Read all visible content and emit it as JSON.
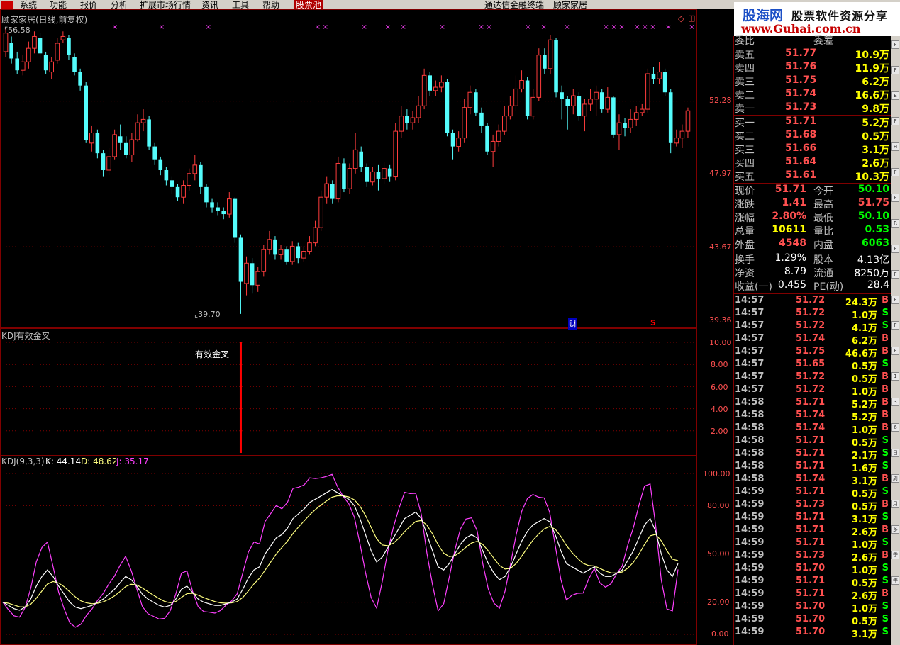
{
  "menu": {
    "items": [
      "系统",
      "功能",
      "报价",
      "分析",
      "扩展市场行情",
      "资讯",
      "工具",
      "帮助",
      "股票池"
    ],
    "center_left": "通达信金融终端",
    "center_right": "顾家家居"
  },
  "brand": {
    "part1": "股海网",
    "part2": "股票软件资源分享",
    "part3": "www.Guhai.com.cn"
  },
  "main_chart": {
    "title": "顾家家居(日线,前复权)",
    "high_label": "56.58",
    "low_label": "39.70",
    "y_ticks": [
      "52.28",
      "47.97",
      "43.67",
      "39.36"
    ],
    "finance_marker": "财",
    "s_marker": "S",
    "candles": [
      {
        "o": 55.2,
        "c": 56.3,
        "h": 56.58,
        "l": 54.9
      },
      {
        "o": 55.7,
        "c": 54.8,
        "h": 56.1,
        "l": 54.5
      },
      {
        "o": 54.8,
        "c": 54.1,
        "h": 55.2,
        "l": 53.9
      },
      {
        "o": 54.1,
        "c": 54.6,
        "h": 55.0,
        "l": 53.8
      },
      {
        "o": 54.6,
        "c": 55.4,
        "h": 55.8,
        "l": 54.2
      },
      {
        "o": 55.4,
        "c": 56.1,
        "h": 56.4,
        "l": 55.1
      },
      {
        "o": 56.0,
        "c": 55.1,
        "h": 56.3,
        "l": 54.8
      },
      {
        "o": 55.0,
        "c": 54.1,
        "h": 55.2,
        "l": 53.9
      },
      {
        "o": 54.0,
        "c": 54.6,
        "h": 54.9,
        "l": 53.6
      },
      {
        "o": 54.7,
        "c": 55.7,
        "h": 56.0,
        "l": 54.5
      },
      {
        "o": 55.9,
        "c": 56.1,
        "h": 56.4,
        "l": 55.7
      },
      {
        "o": 56.0,
        "c": 55.0,
        "h": 56.2,
        "l": 54.7
      },
      {
        "o": 54.9,
        "c": 54.0,
        "h": 55.1,
        "l": 53.8
      },
      {
        "o": 54.0,
        "c": 53.2,
        "h": 54.2,
        "l": 52.9
      },
      {
        "o": 53.2,
        "c": 50.0,
        "h": 53.4,
        "l": 49.8
      },
      {
        "o": 49.8,
        "c": 50.4,
        "h": 50.8,
        "l": 49.3
      },
      {
        "o": 50.4,
        "c": 49.2,
        "h": 50.6,
        "l": 48.9
      },
      {
        "o": 49.2,
        "c": 48.2,
        "h": 49.4,
        "l": 47.8
      },
      {
        "o": 48.2,
        "c": 49.0,
        "h": 49.5,
        "l": 47.9
      },
      {
        "o": 49.0,
        "c": 50.3,
        "h": 50.6,
        "l": 48.8
      },
      {
        "o": 50.2,
        "c": 49.8,
        "h": 50.9,
        "l": 49.4
      },
      {
        "o": 49.8,
        "c": 49.1,
        "h": 50.2,
        "l": 48.9
      },
      {
        "o": 49.1,
        "c": 50.0,
        "h": 50.4,
        "l": 48.7
      },
      {
        "o": 50.0,
        "c": 51.0,
        "h": 51.5,
        "l": 49.9
      },
      {
        "o": 51.0,
        "c": 51.2,
        "h": 51.8,
        "l": 50.5
      },
      {
        "o": 51.2,
        "c": 49.6,
        "h": 51.4,
        "l": 49.4
      },
      {
        "o": 49.6,
        "c": 48.8,
        "h": 49.8,
        "l": 48.5
      },
      {
        "o": 48.8,
        "c": 48.2,
        "h": 49.0,
        "l": 47.9
      },
      {
        "o": 48.2,
        "c": 47.6,
        "h": 48.4,
        "l": 47.3
      },
      {
        "o": 47.6,
        "c": 47.2,
        "h": 47.8,
        "l": 46.8
      },
      {
        "o": 47.2,
        "c": 46.6,
        "h": 47.4,
        "l": 46.4
      },
      {
        "o": 46.6,
        "c": 47.3,
        "h": 47.6,
        "l": 46.2
      },
      {
        "o": 47.3,
        "c": 48.0,
        "h": 48.3,
        "l": 47.0
      },
      {
        "o": 48.0,
        "c": 48.5,
        "h": 49.1,
        "l": 47.6
      },
      {
        "o": 48.5,
        "c": 47.2,
        "h": 48.7,
        "l": 46.8
      },
      {
        "o": 47.2,
        "c": 46.3,
        "h": 47.4,
        "l": 46.0
      },
      {
        "o": 46.3,
        "c": 46.0,
        "h": 46.5,
        "l": 45.7
      },
      {
        "o": 46.0,
        "c": 45.8,
        "h": 46.3,
        "l": 45.5
      },
      {
        "o": 45.8,
        "c": 45.6,
        "h": 46.0,
        "l": 45.3
      },
      {
        "o": 45.6,
        "c": 46.5,
        "h": 46.9,
        "l": 45.4
      },
      {
        "o": 46.5,
        "c": 44.2,
        "h": 46.6,
        "l": 43.9
      },
      {
        "o": 44.2,
        "c": 41.6,
        "h": 44.4,
        "l": 39.7
      },
      {
        "o": 41.5,
        "c": 42.7,
        "h": 43.1,
        "l": 40.8
      },
      {
        "o": 42.7,
        "c": 41.4,
        "h": 43.0,
        "l": 40.9
      },
      {
        "o": 41.4,
        "c": 42.2,
        "h": 42.5,
        "l": 41.0
      },
      {
        "o": 42.2,
        "c": 43.5,
        "h": 43.8,
        "l": 41.9
      },
      {
        "o": 43.5,
        "c": 44.1,
        "h": 44.6,
        "l": 43.2
      },
      {
        "o": 44.1,
        "c": 43.2,
        "h": 44.3,
        "l": 42.9
      },
      {
        "o": 43.2,
        "c": 43.5,
        "h": 43.8,
        "l": 42.9
      },
      {
        "o": 43.5,
        "c": 42.8,
        "h": 43.7,
        "l": 42.6
      },
      {
        "o": 42.8,
        "c": 43.7,
        "h": 44.0,
        "l": 42.6
      },
      {
        "o": 43.7,
        "c": 43.0,
        "h": 43.9,
        "l": 42.7
      },
      {
        "o": 43.0,
        "c": 43.4,
        "h": 43.7,
        "l": 42.8
      },
      {
        "o": 43.4,
        "c": 43.9,
        "h": 44.3,
        "l": 43.2
      },
      {
        "o": 43.9,
        "c": 44.8,
        "h": 45.2,
        "l": 43.7
      },
      {
        "o": 44.8,
        "c": 46.6,
        "h": 47.0,
        "l": 44.6
      },
      {
        "o": 46.6,
        "c": 47.4,
        "h": 47.8,
        "l": 46.2
      },
      {
        "o": 47.4,
        "c": 46.5,
        "h": 47.6,
        "l": 46.2
      },
      {
        "o": 46.5,
        "c": 48.6,
        "h": 49.0,
        "l": 46.3
      },
      {
        "o": 48.6,
        "c": 47.1,
        "h": 48.9,
        "l": 46.9
      },
      {
        "o": 47.1,
        "c": 48.3,
        "h": 48.6,
        "l": 46.8
      },
      {
        "o": 48.3,
        "c": 49.4,
        "h": 50.4,
        "l": 48.0
      },
      {
        "o": 49.3,
        "c": 48.4,
        "h": 49.6,
        "l": 48.1
      },
      {
        "o": 48.4,
        "c": 47.5,
        "h": 48.6,
        "l": 47.2
      },
      {
        "o": 47.5,
        "c": 48.1,
        "h": 48.4,
        "l": 47.3
      },
      {
        "o": 48.1,
        "c": 47.7,
        "h": 48.5,
        "l": 47.0
      },
      {
        "o": 47.7,
        "c": 48.3,
        "h": 48.7,
        "l": 47.4
      },
      {
        "o": 48.3,
        "c": 47.8,
        "h": 48.5,
        "l": 47.5
      },
      {
        "o": 47.8,
        "c": 50.5,
        "h": 51.0,
        "l": 47.6
      },
      {
        "o": 50.5,
        "c": 51.4,
        "h": 52.0,
        "l": 50.1
      },
      {
        "o": 51.4,
        "c": 51.0,
        "h": 51.8,
        "l": 50.6
      },
      {
        "o": 51.0,
        "c": 51.3,
        "h": 51.7,
        "l": 50.6
      },
      {
        "o": 51.3,
        "c": 52.0,
        "h": 52.6,
        "l": 51.0
      },
      {
        "o": 52.0,
        "c": 53.8,
        "h": 54.2,
        "l": 51.8
      },
      {
        "o": 53.8,
        "c": 52.9,
        "h": 54.0,
        "l": 52.6
      },
      {
        "o": 52.9,
        "c": 53.1,
        "h": 53.5,
        "l": 52.6
      },
      {
        "o": 53.1,
        "c": 53.4,
        "h": 53.8,
        "l": 52.8
      },
      {
        "o": 53.4,
        "c": 50.4,
        "h": 53.6,
        "l": 50.2
      },
      {
        "o": 50.4,
        "c": 49.6,
        "h": 50.6,
        "l": 48.8
      },
      {
        "o": 49.6,
        "c": 50.1,
        "h": 50.5,
        "l": 49.3
      },
      {
        "o": 50.1,
        "c": 51.9,
        "h": 52.4,
        "l": 49.8
      },
      {
        "o": 51.9,
        "c": 52.8,
        "h": 53.2,
        "l": 51.5
      },
      {
        "o": 52.8,
        "c": 51.6,
        "h": 53.0,
        "l": 51.4
      },
      {
        "o": 51.6,
        "c": 50.8,
        "h": 51.9,
        "l": 50.4
      },
      {
        "o": 50.8,
        "c": 49.3,
        "h": 51.0,
        "l": 49.1
      },
      {
        "o": 49.3,
        "c": 49.9,
        "h": 50.3,
        "l": 48.4
      },
      {
        "o": 49.9,
        "c": 50.5,
        "h": 50.9,
        "l": 49.6
      },
      {
        "o": 50.5,
        "c": 51.4,
        "h": 52.0,
        "l": 50.3
      },
      {
        "o": 51.4,
        "c": 52.0,
        "h": 52.6,
        "l": 51.2
      },
      {
        "o": 52.0,
        "c": 53.0,
        "h": 53.8,
        "l": 51.7
      },
      {
        "o": 53.0,
        "c": 53.5,
        "h": 54.1,
        "l": 52.8
      },
      {
        "o": 53.5,
        "c": 51.4,
        "h": 53.7,
        "l": 51.2
      },
      {
        "o": 51.4,
        "c": 52.5,
        "h": 53.0,
        "l": 51.2
      },
      {
        "o": 52.5,
        "c": 55.0,
        "h": 55.4,
        "l": 52.3
      },
      {
        "o": 55.0,
        "c": 54.2,
        "h": 55.4,
        "l": 53.9
      },
      {
        "o": 54.2,
        "c": 55.9,
        "h": 56.2,
        "l": 53.9
      },
      {
        "o": 55.9,
        "c": 52.8,
        "h": 56.0,
        "l": 52.5
      },
      {
        "o": 52.8,
        "c": 52.4,
        "h": 53.2,
        "l": 51.2
      },
      {
        "o": 52.4,
        "c": 52.0,
        "h": 52.6,
        "l": 50.6
      },
      {
        "o": 52.0,
        "c": 52.6,
        "h": 53.0,
        "l": 51.5
      },
      {
        "o": 52.6,
        "c": 51.4,
        "h": 52.8,
        "l": 51.1
      },
      {
        "o": 51.4,
        "c": 52.1,
        "h": 52.4,
        "l": 50.5
      },
      {
        "o": 52.1,
        "c": 52.4,
        "h": 53.0,
        "l": 51.7
      },
      {
        "o": 52.4,
        "c": 52.8,
        "h": 53.2,
        "l": 51.4
      },
      {
        "o": 52.8,
        "c": 51.8,
        "h": 53.0,
        "l": 51.6
      },
      {
        "o": 51.8,
        "c": 52.5,
        "h": 53.1,
        "l": 51.6
      },
      {
        "o": 52.5,
        "c": 50.3,
        "h": 52.6,
        "l": 50.1
      },
      {
        "o": 50.3,
        "c": 51.0,
        "h": 51.5,
        "l": 49.4
      },
      {
        "o": 51.0,
        "c": 50.7,
        "h": 51.3,
        "l": 50.2
      },
      {
        "o": 50.7,
        "c": 51.2,
        "h": 51.8,
        "l": 50.4
      },
      {
        "o": 51.2,
        "c": 51.6,
        "h": 52.0,
        "l": 50.8
      },
      {
        "o": 51.6,
        "c": 51.8,
        "h": 52.1,
        "l": 51.4
      },
      {
        "o": 51.8,
        "c": 53.9,
        "h": 54.2,
        "l": 51.6
      },
      {
        "o": 53.9,
        "c": 53.6,
        "h": 54.3,
        "l": 53.3
      },
      {
        "o": 53.6,
        "c": 54.0,
        "h": 54.6,
        "l": 53.3
      },
      {
        "o": 54.0,
        "c": 52.8,
        "h": 54.2,
        "l": 52.6
      },
      {
        "o": 52.8,
        "c": 49.8,
        "h": 53.0,
        "l": 49.2
      },
      {
        "o": 49.8,
        "c": 50.1,
        "h": 50.6,
        "l": 49.6
      },
      {
        "o": 50.1,
        "c": 50.5,
        "h": 50.9,
        "l": 49.5
      },
      {
        "o": 50.5,
        "c": 51.71,
        "h": 51.9,
        "l": 50.1
      }
    ],
    "markers_x": [
      14,
      20,
      26,
      40,
      41,
      46,
      49,
      51,
      56,
      61,
      62,
      67,
      69,
      72,
      77,
      78,
      79,
      81,
      82,
      83,
      85,
      88
    ]
  },
  "kdj_signal": {
    "title": "KDJ有效金叉",
    "signal_label": "有效金叉",
    "y_ticks": [
      "10.00",
      "8.00",
      "6.00",
      "4.00",
      "2.00"
    ],
    "signal_index": 41,
    "signal_value": 10
  },
  "kdj": {
    "title": "KDJ(9,3,3)",
    "k_label": "K: 44.14",
    "d_label": "D: 48.62",
    "j_label": "J: 35.17",
    "y_ticks": [
      "100.00",
      "80.00",
      "50.00",
      "20.00",
      "0.00"
    ],
    "colors": {
      "k": "#ffffff",
      "d": "#ffff80",
      "j": "#ff40ff"
    },
    "k": [
      20,
      18,
      16,
      15,
      17,
      22,
      30,
      36,
      40,
      36,
      30,
      25,
      20,
      17,
      16,
      17,
      18,
      20,
      22,
      25,
      28,
      32,
      36,
      34,
      30,
      25,
      22,
      20,
      18,
      17,
      18,
      22,
      28,
      30,
      26,
      22,
      20,
      19,
      18,
      18,
      19,
      20,
      22,
      28,
      35,
      40,
      42,
      50,
      55,
      60,
      62,
      66,
      72,
      75,
      78,
      82,
      84,
      86,
      88,
      90,
      88,
      86,
      84,
      80,
      72,
      62,
      52,
      45,
      48,
      54,
      60,
      66,
      72,
      74,
      76,
      72,
      62,
      52,
      42,
      40,
      44,
      50,
      56,
      60,
      62,
      60,
      52,
      44,
      38,
      34,
      36,
      42,
      50,
      58,
      64,
      68,
      70,
      72,
      70,
      62,
      52,
      44,
      42,
      40,
      38,
      40,
      42,
      38,
      36,
      36,
      38,
      40,
      46,
      52,
      60,
      68,
      72,
      64,
      50,
      40,
      36,
      44
    ]
  },
  "quote": {
    "webi_label": "委比",
    "webi_value": "",
    "wecha_label": "委差",
    "wecha_value": "",
    "sell": [
      {
        "label": "卖五",
        "price": "51.77",
        "vol": "10.9万"
      },
      {
        "label": "卖四",
        "price": "51.76",
        "vol": "11.9万"
      },
      {
        "label": "卖三",
        "price": "51.75",
        "vol": "6.2万"
      },
      {
        "label": "卖二",
        "price": "51.74",
        "vol": "16.6万"
      },
      {
        "label": "卖一",
        "price": "51.73",
        "vol": "9.8万"
      }
    ],
    "buy": [
      {
        "label": "买一",
        "price": "51.71",
        "vol": "5.2万"
      },
      {
        "label": "买二",
        "price": "51.68",
        "vol": "0.5万"
      },
      {
        "label": "买三",
        "price": "51.66",
        "vol": "3.1万"
      },
      {
        "label": "买四",
        "price": "51.64",
        "vol": "2.6万"
      },
      {
        "label": "买五",
        "price": "51.61",
        "vol": "10.3万"
      }
    ],
    "stats": [
      {
        "l1": "现价",
        "v1": "51.71",
        "c1": "red",
        "l2": "今开",
        "v2": "50.10",
        "c2": "green"
      },
      {
        "l1": "涨跌",
        "v1": "1.41",
        "c1": "red",
        "l2": "最高",
        "v2": "51.75",
        "c2": "red"
      },
      {
        "l1": "涨幅",
        "v1": "2.80%",
        "c1": "red",
        "l2": "最低",
        "v2": "50.10",
        "c2": "green"
      },
      {
        "l1": "总量",
        "v1": "10611",
        "c1": "yellow",
        "l2": "量比",
        "v2": "0.53",
        "c2": "green"
      },
      {
        "l1": "外盘",
        "v1": "4548",
        "c1": "red",
        "l2": "内盘",
        "v2": "6063",
        "c2": "green"
      }
    ],
    "fund": [
      {
        "l1": "换手",
        "v1": "1.29%",
        "l2": "股本",
        "v2": "4.13亿"
      },
      {
        "l1": "净资",
        "v1": "8.79",
        "l2": "流通",
        "v2": "8250万"
      },
      {
        "l1": "收益(一)",
        "v1": "0.455",
        "l2": "PE(动)",
        "v2": "28.4"
      }
    ]
  },
  "ticks": [
    {
      "t": "14:57",
      "p": "51.72",
      "pc": "red",
      "q": "24.3万",
      "s": "B"
    },
    {
      "t": "14:57",
      "p": "51.72",
      "pc": "red",
      "q": "1.0万",
      "s": "S"
    },
    {
      "t": "14:57",
      "p": "51.72",
      "pc": "red",
      "q": "4.1万",
      "s": "S"
    },
    {
      "t": "14:57",
      "p": "51.74",
      "pc": "red",
      "q": "6.2万",
      "s": "B"
    },
    {
      "t": "14:57",
      "p": "51.75",
      "pc": "red",
      "q": "46.6万",
      "s": "B"
    },
    {
      "t": "14:57",
      "p": "51.65",
      "pc": "red",
      "q": "0.5万",
      "s": "S"
    },
    {
      "t": "14:57",
      "p": "51.72",
      "pc": "red",
      "q": "0.5万",
      "s": "B"
    },
    {
      "t": "14:57",
      "p": "51.72",
      "pc": "red",
      "q": "1.0万",
      "s": "B"
    },
    {
      "t": "14:58",
      "p": "51.71",
      "pc": "red",
      "q": "5.2万",
      "s": "B"
    },
    {
      "t": "14:58",
      "p": "51.74",
      "pc": "red",
      "q": "5.2万",
      "s": "B"
    },
    {
      "t": "14:58",
      "p": "51.74",
      "pc": "red",
      "q": "1.0万",
      "s": "B"
    },
    {
      "t": "14:58",
      "p": "51.71",
      "pc": "red",
      "q": "0.5万",
      "s": "S"
    },
    {
      "t": "14:58",
      "p": "51.71",
      "pc": "red",
      "q": "2.1万",
      "s": "S"
    },
    {
      "t": "14:58",
      "p": "51.71",
      "pc": "red",
      "q": "1.6万",
      "s": "S"
    },
    {
      "t": "14:58",
      "p": "51.74",
      "pc": "red",
      "q": "3.1万",
      "s": "B"
    },
    {
      "t": "14:59",
      "p": "51.71",
      "pc": "red",
      "q": "0.5万",
      "s": "S"
    },
    {
      "t": "14:59",
      "p": "51.73",
      "pc": "red",
      "q": "0.5万",
      "s": "B"
    },
    {
      "t": "14:59",
      "p": "51.71",
      "pc": "red",
      "q": "3.1万",
      "s": "S"
    },
    {
      "t": "14:59",
      "p": "51.71",
      "pc": "red",
      "q": "2.6万",
      "s": "B"
    },
    {
      "t": "14:59",
      "p": "51.71",
      "pc": "red",
      "q": "1.0万",
      "s": "S"
    },
    {
      "t": "14:59",
      "p": "51.73",
      "pc": "red",
      "q": "2.6万",
      "s": "B"
    },
    {
      "t": "14:59",
      "p": "51.70",
      "pc": "red",
      "q": "1.0万",
      "s": "S"
    },
    {
      "t": "14:59",
      "p": "51.71",
      "pc": "red",
      "q": "0.5万",
      "s": "S"
    },
    {
      "t": "14:59",
      "p": "51.71",
      "pc": "red",
      "q": "2.6万",
      "s": "B"
    },
    {
      "t": "14:59",
      "p": "51.70",
      "pc": "red",
      "q": "1.0万",
      "s": "S"
    },
    {
      "t": "14:59",
      "p": "51.70",
      "pc": "red",
      "q": "0.5万",
      "s": "S"
    },
    {
      "t": "14:59",
      "p": "51.70",
      "pc": "red",
      "q": "3.1万",
      "s": "S"
    }
  ],
  "right_toolbar_labels": [
    "F",
    "F",
    "E",
    "F",
    "H",
    "F",
    "F",
    "R",
    "F",
    "F",
    "F",
    "F",
    "F",
    "1",
    "3",
    "6",
    "日",
    "周",
    "月",
    "多",
    "季",
    "年"
  ]
}
